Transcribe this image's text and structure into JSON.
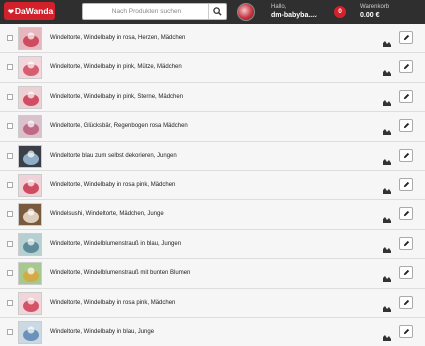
{
  "header": {
    "logo": "DaWanda",
    "search_placeholder": "Nach Produkten suchen",
    "greeting": "Hallo,",
    "username": "dm-babyba...",
    "cart_count": "0",
    "cart_label": "Warenkorb",
    "cart_total": "0.00 €"
  },
  "products": [
    {
      "title": "Windeltorte, Windelbaby in rosa, Herzen, Mädchen",
      "thumb": [
        "#e7b7c0",
        "#c93a4e"
      ]
    },
    {
      "title": "Windeltorte, Windelbaby in pink, Mütze, Mädchen",
      "thumb": [
        "#f1d7db",
        "#d2485e"
      ]
    },
    {
      "title": "Windeltorte, Windelbaby in pink, Sterne, Mädchen",
      "thumb": [
        "#ecd0d4",
        "#cc3650"
      ]
    },
    {
      "title": "Windeltorte, Glücksbär, Regenbogen rosa Mädchen",
      "thumb": [
        "#d9c2cc",
        "#b85a7a"
      ]
    },
    {
      "title": "Windeltorte blau zum selbst dekorieren, Jungen",
      "thumb": [
        "#3b3f48",
        "#9fc3df"
      ]
    },
    {
      "title": "Windeltorte, Windelbaby in rosa pink, Mädchen",
      "thumb": [
        "#efd3d8",
        "#c9324a"
      ]
    },
    {
      "title": "Windelsushi, Windeltorte, Mädchen, Junge",
      "thumb": [
        "#7a5a3c",
        "#efe4d2"
      ]
    },
    {
      "title": "Windeltorte, Windelblumenstrauß in blau, Jungen",
      "thumb": [
        "#b6d0d2",
        "#4e7f8e"
      ]
    },
    {
      "title": "Windeltorte, Windelblumenstrauß mit bunten Blumen",
      "thumb": [
        "#a8c98e",
        "#d8a63a"
      ]
    },
    {
      "title": "Windeltorte, Windelbaby in rosa pink, Mädchen",
      "thumb": [
        "#f0d5da",
        "#cf3c52"
      ]
    },
    {
      "title": "Windeltorte, Windelbaby in blau, Junge",
      "thumb": [
        "#cad9e4",
        "#5b86b1"
      ]
    }
  ]
}
